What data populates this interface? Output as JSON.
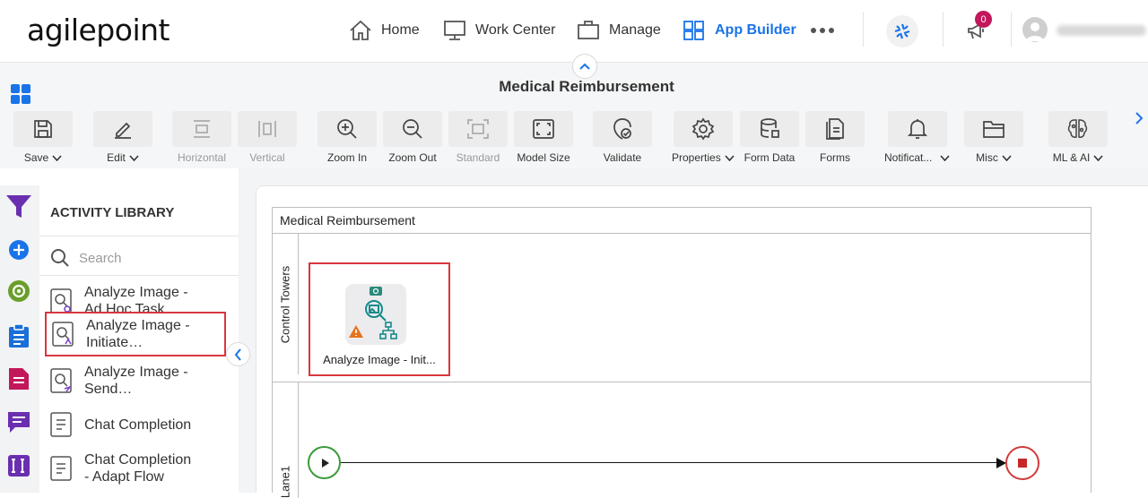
{
  "brand": {
    "logo_text": "agilepoint"
  },
  "nav": {
    "items": [
      {
        "label": "Home",
        "icon": "home-icon"
      },
      {
        "label": "Work Center",
        "icon": "monitor-icon"
      },
      {
        "label": "Manage",
        "icon": "briefcase-icon"
      },
      {
        "label": "App Builder",
        "icon": "grid-icon",
        "active": true
      }
    ],
    "more_icon": "more-horizontal-icon",
    "notification_count": "0"
  },
  "header": {
    "title": "Medical Reimbursement"
  },
  "toolbar": {
    "tools": [
      {
        "label": "Save",
        "icon": "save-icon",
        "dropdown": true,
        "enabled": true
      },
      {
        "label": "Edit",
        "icon": "pencil-icon",
        "dropdown": true,
        "enabled": true
      },
      {
        "label": "Horizontal",
        "icon": "align-horizontal-icon",
        "enabled": false
      },
      {
        "label": "Vertical",
        "icon": "align-vertical-icon",
        "enabled": false
      },
      {
        "label": "Zoom In",
        "icon": "zoom-in-icon",
        "enabled": true
      },
      {
        "label": "Zoom Out",
        "icon": "zoom-out-icon",
        "enabled": true
      },
      {
        "label": "Standard",
        "icon": "standard-size-icon",
        "enabled": false
      },
      {
        "label": "Model Size",
        "icon": "model-size-icon",
        "enabled": true
      },
      {
        "label": "Validate",
        "icon": "validate-icon",
        "enabled": true
      },
      {
        "label": "Properties",
        "icon": "gear-icon",
        "dropdown": true,
        "enabled": true
      },
      {
        "label": "Form Data",
        "icon": "database-icon",
        "enabled": true
      },
      {
        "label": "Forms",
        "icon": "forms-icon",
        "enabled": true
      },
      {
        "label": "Notificat...",
        "icon": "bell-icon",
        "dropdown": true,
        "enabled": true
      },
      {
        "label": "Misc",
        "icon": "folder-icon",
        "dropdown": true,
        "enabled": true
      },
      {
        "label": "ML & AI",
        "icon": "ai-brain-icon",
        "dropdown": true,
        "enabled": true
      }
    ]
  },
  "library": {
    "title": "ACTIVITY LIBRARY",
    "search_placeholder": "Search",
    "items": [
      {
        "line1": "Analyze Image -",
        "line2": "Ad Hoc Task"
      },
      {
        "line1": "Analyze Image -",
        "line2": "Initiate…",
        "selected": true
      },
      {
        "line1": "Analyze Image -",
        "line2": "Send…"
      },
      {
        "line1": "Chat Completion",
        "line2": ""
      },
      {
        "line1": "Chat Completion",
        "line2": "- Adapt Flow"
      }
    ]
  },
  "canvas": {
    "pool_title": "Medical Reimbursement",
    "lanes": [
      {
        "label": "Control Towers"
      },
      {
        "label": "Lane1"
      }
    ],
    "activity": {
      "name": "Analyze Image - Init..."
    }
  },
  "colors": {
    "accent": "#1a73e8",
    "selection": "#d9363e",
    "start": "#3a9a3a",
    "end": "#d23b3b"
  }
}
